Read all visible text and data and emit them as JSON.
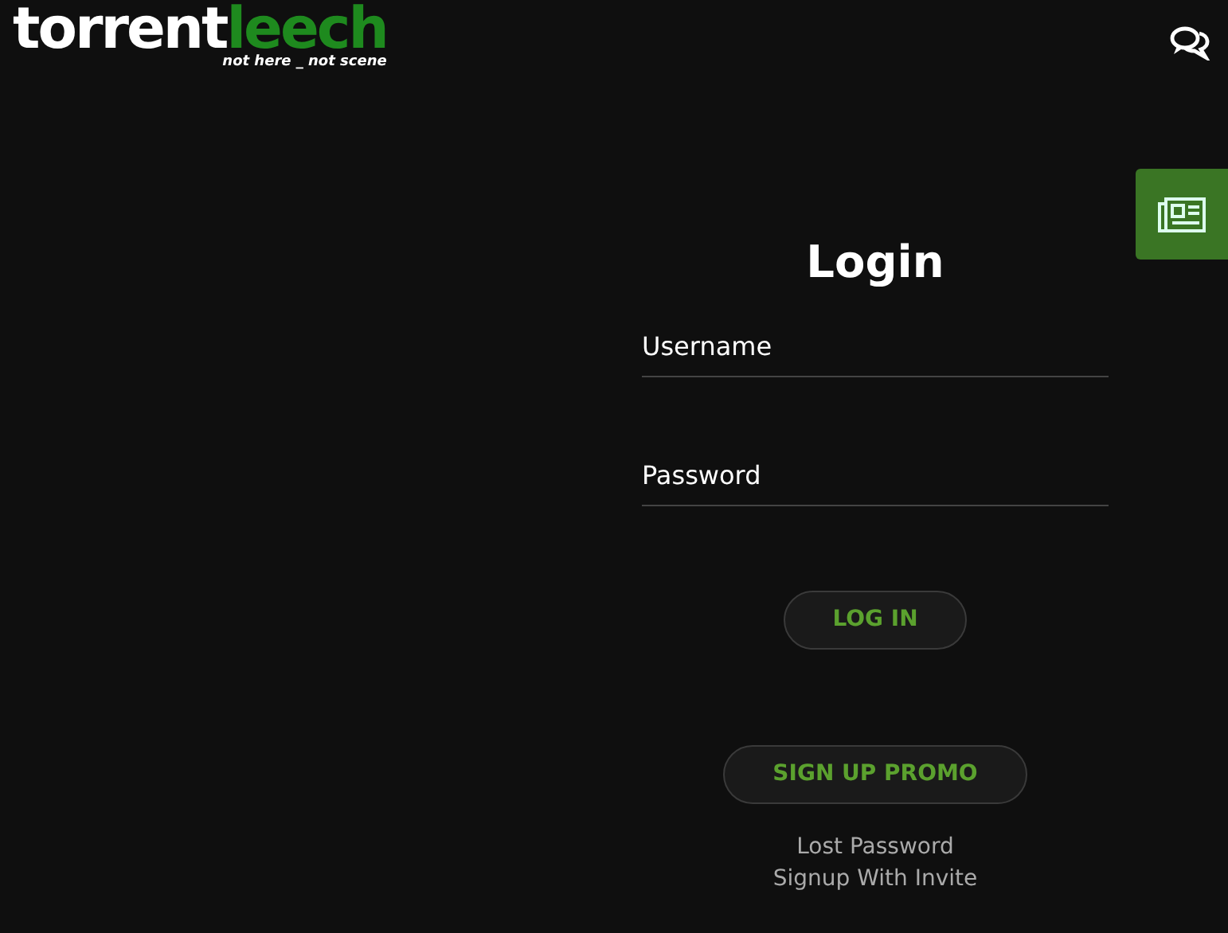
{
  "logo": {
    "first": "torrent",
    "second": "leech",
    "tagline": "not here _ not scene"
  },
  "title": "Login",
  "fields": [
    {
      "placeholder": "Username"
    },
    {
      "placeholder": "Password"
    }
  ],
  "buttons": [
    "LOG IN",
    "SIGN UP PROMO"
  ],
  "links": [
    "Lost Password",
    "Signup With Invite"
  ]
}
